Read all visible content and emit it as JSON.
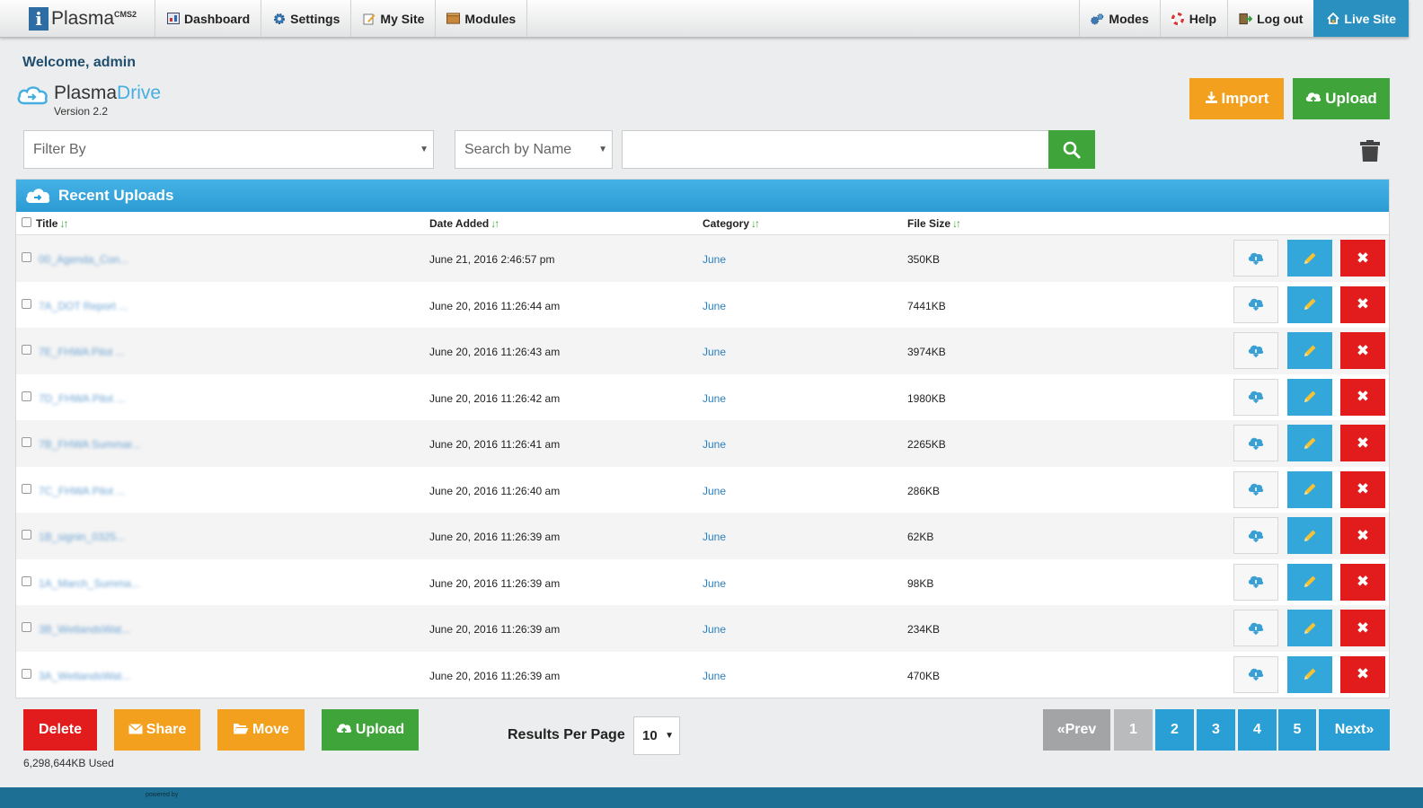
{
  "nav": {
    "brand_name": "Plasma",
    "brand_sup": "CMS2",
    "left": [
      {
        "label": "Dashboard",
        "icon": "dashboard-icon"
      },
      {
        "label": "Settings",
        "icon": "gear-icon"
      },
      {
        "label": "My Site",
        "icon": "edit-page-icon"
      },
      {
        "label": "Modules",
        "icon": "box-icon"
      }
    ],
    "right": [
      {
        "label": "Modes",
        "icon": "gears-icon"
      },
      {
        "label": "Help",
        "icon": "lifebuoy-icon"
      },
      {
        "label": "Log out",
        "icon": "logout-icon"
      },
      {
        "label": "Live Site",
        "icon": "home-icon"
      }
    ]
  },
  "welcome": "Welcome, admin",
  "drive": {
    "title_main": "Plasma",
    "title_accent": "Drive",
    "version": "Version 2.2"
  },
  "actions": {
    "import_label": "Import",
    "upload_label": "Upload"
  },
  "filters": {
    "filter_by": "Filter By",
    "search_by": "Search by Name",
    "search_value": ""
  },
  "panel": {
    "title": "Recent Uploads",
    "columns": {
      "title": "Title",
      "date": "Date Added",
      "category": "Category",
      "size": "File Size"
    },
    "rows": [
      {
        "title": "00_Agenda_Con...",
        "date": "June 21, 2016 2:46:57 pm",
        "category": "June",
        "size": "350KB"
      },
      {
        "title": "7A_DOT Report ...",
        "date": "June 20, 2016 11:26:44 am",
        "category": "June",
        "size": "7441KB"
      },
      {
        "title": "7E_FHWA Pilot ...",
        "date": "June 20, 2016 11:26:43 am",
        "category": "June",
        "size": "3974KB"
      },
      {
        "title": "7D_FHWA Pilot ...",
        "date": "June 20, 2016 11:26:42 am",
        "category": "June",
        "size": "1980KB"
      },
      {
        "title": "7B_FHWA Summar...",
        "date": "June 20, 2016 11:26:41 am",
        "category": "June",
        "size": "2265KB"
      },
      {
        "title": "7C_FHWA Pilot ...",
        "date": "June 20, 2016 11:26:40 am",
        "category": "June",
        "size": "286KB"
      },
      {
        "title": "1B_signin_0325...",
        "date": "June 20, 2016 11:26:39 am",
        "category": "June",
        "size": "62KB"
      },
      {
        "title": "1A_March_Summa...",
        "date": "June 20, 2016 11:26:39 am",
        "category": "June",
        "size": "98KB"
      },
      {
        "title": "3B_WetlandsWat...",
        "date": "June 20, 2016 11:26:39 am",
        "category": "June",
        "size": "234KB"
      },
      {
        "title": "3A_WetlandsWat...",
        "date": "June 20, 2016 11:26:39 am",
        "category": "June",
        "size": "470KB"
      }
    ]
  },
  "footer": {
    "delete_label": "Delete",
    "share_label": "Share",
    "move_label": "Move",
    "upload_label": "Upload",
    "used": "6,298,644KB Used",
    "results_per_page_label": "Results Per Page",
    "results_per_page_value": "10",
    "pager": {
      "prev": "«Prev",
      "pages": [
        "1",
        "2",
        "3",
        "4",
        "5"
      ],
      "next": "Next»"
    },
    "powered_by": "powered by"
  },
  "colors": {
    "accent_blue": "#2a9fd6",
    "green": "#3fa53a",
    "orange": "#f4a01f",
    "red": "#e21c1c"
  }
}
